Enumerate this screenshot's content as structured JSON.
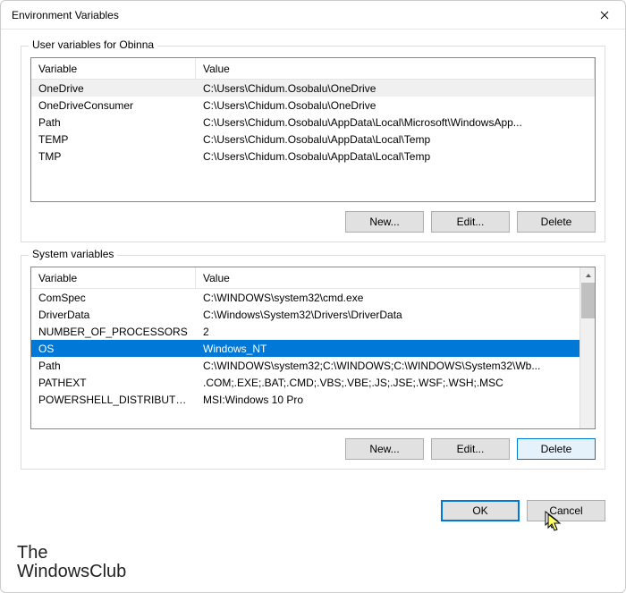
{
  "window": {
    "title": "Environment Variables"
  },
  "user_group": {
    "label": "User variables for Obinna",
    "headers": {
      "variable": "Variable",
      "value": "Value"
    },
    "rows": [
      {
        "variable": "OneDrive",
        "value": "C:\\Users\\Chidum.Osobalu\\OneDrive"
      },
      {
        "variable": "OneDriveConsumer",
        "value": "C:\\Users\\Chidum.Osobalu\\OneDrive"
      },
      {
        "variable": "Path",
        "value": "C:\\Users\\Chidum.Osobalu\\AppData\\Local\\Microsoft\\WindowsApp..."
      },
      {
        "variable": "TEMP",
        "value": "C:\\Users\\Chidum.Osobalu\\AppData\\Local\\Temp"
      },
      {
        "variable": "TMP",
        "value": "C:\\Users\\Chidum.Osobalu\\AppData\\Local\\Temp"
      }
    ],
    "buttons": {
      "new": "New...",
      "edit": "Edit...",
      "delete": "Delete"
    }
  },
  "system_group": {
    "label": "System variables",
    "headers": {
      "variable": "Variable",
      "value": "Value"
    },
    "rows": [
      {
        "variable": "ComSpec",
        "value": "C:\\WINDOWS\\system32\\cmd.exe"
      },
      {
        "variable": "DriverData",
        "value": "C:\\Windows\\System32\\Drivers\\DriverData"
      },
      {
        "variable": "NUMBER_OF_PROCESSORS",
        "value": "2"
      },
      {
        "variable": "OS",
        "value": "Windows_NT"
      },
      {
        "variable": "Path",
        "value": "C:\\WINDOWS\\system32;C:\\WINDOWS;C:\\WINDOWS\\System32\\Wb..."
      },
      {
        "variable": "PATHEXT",
        "value": ".COM;.EXE;.BAT;.CMD;.VBS;.VBE;.JS;.JSE;.WSF;.WSH;.MSC"
      },
      {
        "variable": "POWERSHELL_DISTRIBUTIO...",
        "value": "MSI:Windows 10 Pro"
      }
    ],
    "selected_index": 3,
    "buttons": {
      "new": "New...",
      "edit": "Edit...",
      "delete": "Delete"
    }
  },
  "footer": {
    "ok": "OK",
    "cancel": "Cancel"
  },
  "watermark": {
    "line1": "The",
    "line2": "WindowsClub"
  }
}
